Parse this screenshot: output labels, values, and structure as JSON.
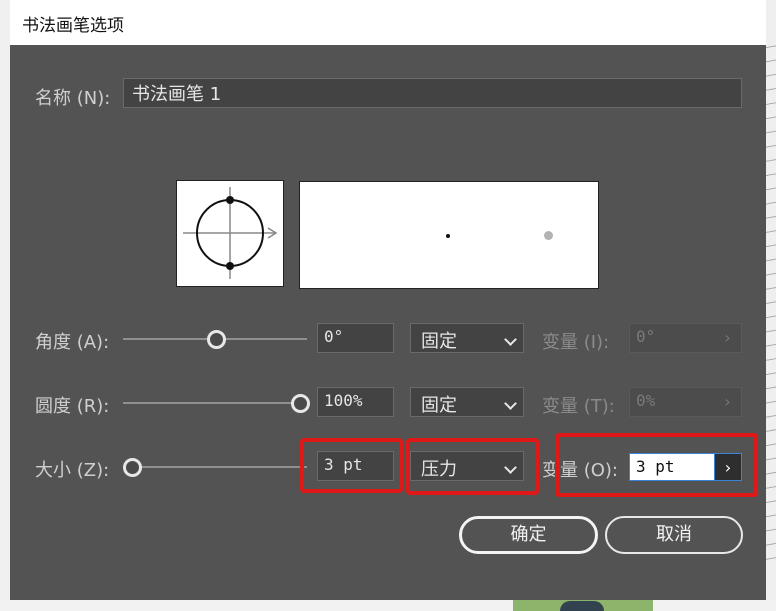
{
  "dialog": {
    "title": "书法画笔选项"
  },
  "name_row": {
    "label": "名称 (N):",
    "value": "书法画笔 1"
  },
  "angle_row": {
    "label": "角度 (A):",
    "value": "0°",
    "mode": "固定",
    "variation_label": "变量 (I):",
    "variation_value": "0°",
    "slider_fraction": 0.5
  },
  "roundness_row": {
    "label": "圆度 (R):",
    "value": "100%",
    "mode": "固定",
    "variation_label": "变量 (T):",
    "variation_value": "0%",
    "slider_fraction": 1.0
  },
  "size_row": {
    "label": "大小 (Z):",
    "value": "3 pt",
    "mode": "压力",
    "variation_label": "变量 (O):",
    "variation_value": "3 pt",
    "slider_fraction": 0.0
  },
  "buttons": {
    "ok": "确定",
    "cancel": "取消"
  },
  "colors": {
    "dialog_bg": "#535353",
    "highlight": "#e01818",
    "focus": "#3b83d6"
  },
  "icons": {
    "dropdown": "chevron-down-icon",
    "arrow": "chevron-right-icon"
  }
}
